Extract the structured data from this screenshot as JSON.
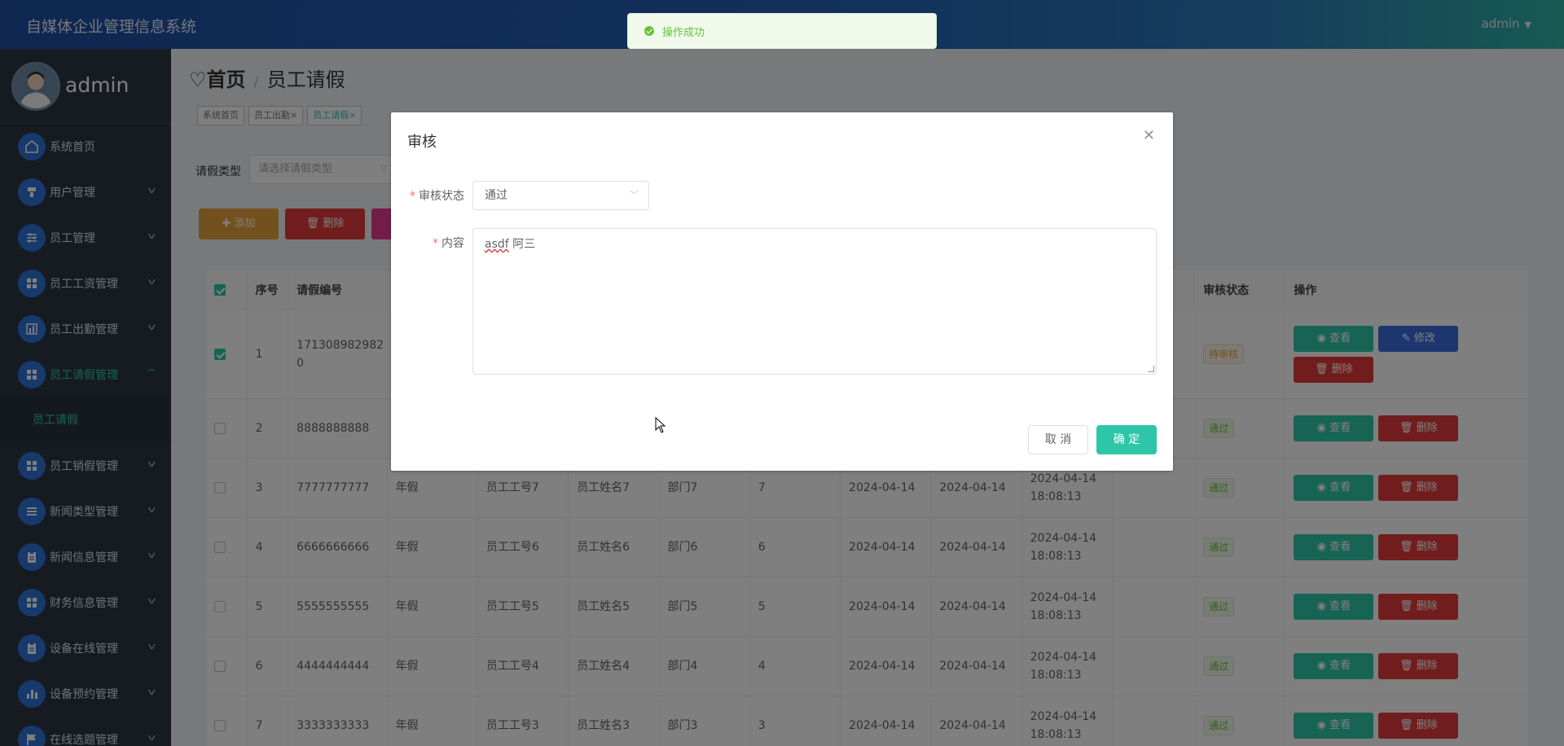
{
  "header": {
    "title": "自媒体企业管理信息系统",
    "user": "admin"
  },
  "toast": {
    "message": "操作成功"
  },
  "sidebar": {
    "username": "admin",
    "items": [
      {
        "label": "系统首页",
        "icon": "home-icon",
        "has_children": false
      },
      {
        "label": "用户管理",
        "icon": "user-icon",
        "has_children": true
      },
      {
        "label": "员工管理",
        "icon": "sliders-icon",
        "has_children": true
      },
      {
        "label": "员工工资管理",
        "icon": "grid-icon",
        "has_children": true
      },
      {
        "label": "员工出勤管理",
        "icon": "chart-icon",
        "has_children": true
      },
      {
        "label": "员工请假管理",
        "icon": "grid-icon",
        "has_children": true,
        "active": true,
        "children": [
          {
            "label": "员工请假"
          }
        ]
      },
      {
        "label": "员工销假管理",
        "icon": "grid-icon",
        "has_children": true
      },
      {
        "label": "新闻类型管理",
        "icon": "list-icon",
        "has_children": true
      },
      {
        "label": "新闻信息管理",
        "icon": "clipboard-icon",
        "has_children": true
      },
      {
        "label": "财务信息管理",
        "icon": "grid-icon",
        "has_children": true
      },
      {
        "label": "设备在线管理",
        "icon": "clipboard-icon",
        "has_children": true
      },
      {
        "label": "设备预约管理",
        "icon": "bar-icon",
        "has_children": true
      },
      {
        "label": "在线选题管理",
        "icon": "flag-icon",
        "has_children": true
      }
    ]
  },
  "breadcrumb": {
    "home": "首页",
    "sep": "/",
    "current": "员工请假"
  },
  "tags": [
    {
      "label": "系统首页",
      "closable": false
    },
    {
      "label": "员工出勤",
      "closable": true
    },
    {
      "label": "员工请假",
      "closable": true,
      "current": true
    }
  ],
  "filter": {
    "label": "请假类型",
    "placeholder": "请选择请假类型"
  },
  "toolbar": {
    "add": "添加",
    "delete": "删除"
  },
  "table": {
    "headers": {
      "index": "序号",
      "code": "请假编号",
      "status": "审核状态",
      "actions": "操作"
    },
    "rows": [
      {
        "idx": "1",
        "code": "1713089829820",
        "type": "",
        "emp_no": "",
        "emp_name": "",
        "dept": "",
        "days": "",
        "start": "",
        "end": "",
        "created": "",
        "created_time": "",
        "status": "待审核",
        "status_kind": "pend",
        "checked": true,
        "actions": [
          "view",
          "edit",
          "del"
        ]
      },
      {
        "idx": "2",
        "code": "8888888888",
        "type": "",
        "emp_no": "",
        "emp_name": "",
        "dept": "",
        "days": "",
        "start": "",
        "end": "",
        "created": "",
        "created_time": "",
        "status": "通过",
        "status_kind": "pass",
        "checked": false,
        "actions": [
          "view",
          "del"
        ]
      },
      {
        "idx": "3",
        "code": "7777777777",
        "type": "年假",
        "emp_no": "员工工号7",
        "emp_name": "员工姓名7",
        "dept": "部门7",
        "days": "7",
        "start": "2024-04-14",
        "end": "2024-04-14",
        "created": "2024-04-14",
        "created_time": "18:08:13",
        "status": "通过",
        "status_kind": "pass",
        "checked": false,
        "actions": [
          "view",
          "del"
        ]
      },
      {
        "idx": "4",
        "code": "6666666666",
        "type": "年假",
        "emp_no": "员工工号6",
        "emp_name": "员工姓名6",
        "dept": "部门6",
        "days": "6",
        "start": "2024-04-14",
        "end": "2024-04-14",
        "created": "2024-04-14",
        "created_time": "18:08:13",
        "status": "通过",
        "status_kind": "pass",
        "checked": false,
        "actions": [
          "view",
          "del"
        ]
      },
      {
        "idx": "5",
        "code": "5555555555",
        "type": "年假",
        "emp_no": "员工工号5",
        "emp_name": "员工姓名5",
        "dept": "部门5",
        "days": "5",
        "start": "2024-04-14",
        "end": "2024-04-14",
        "created": "2024-04-14",
        "created_time": "18:08:13",
        "status": "通过",
        "status_kind": "pass",
        "checked": false,
        "actions": [
          "view",
          "del"
        ]
      },
      {
        "idx": "6",
        "code": "4444444444",
        "type": "年假",
        "emp_no": "员工工号4",
        "emp_name": "员工姓名4",
        "dept": "部门4",
        "days": "4",
        "start": "2024-04-14",
        "end": "2024-04-14",
        "created": "2024-04-14",
        "created_time": "18:08:13",
        "status": "通过",
        "status_kind": "pass",
        "checked": false,
        "actions": [
          "view",
          "del"
        ]
      },
      {
        "idx": "7",
        "code": "3333333333",
        "type": "年假",
        "emp_no": "员工工号3",
        "emp_name": "员工姓名3",
        "dept": "部门3",
        "days": "3",
        "start": "2024-04-14",
        "end": "2024-04-14",
        "created": "2024-04-14",
        "created_time": "18:08:13",
        "status": "通过",
        "status_kind": "pass",
        "checked": false,
        "actions": [
          "view",
          "del"
        ]
      }
    ],
    "action_labels": {
      "view": "查看",
      "edit": "修改",
      "del": "删除"
    }
  },
  "dialog": {
    "title": "审核",
    "status_label": "审核状态",
    "status_value": "通过",
    "content_label": "内容",
    "content_word1": "asdf",
    "content_word2": "阿三",
    "cancel": "取 消",
    "confirm": "确 定"
  },
  "colors": {
    "accent": "#2ec6a8",
    "primary": "#3a6fdc",
    "danger": "#e23b3b",
    "warning": "#e6a23c",
    "sidebar": "#2c3645"
  }
}
